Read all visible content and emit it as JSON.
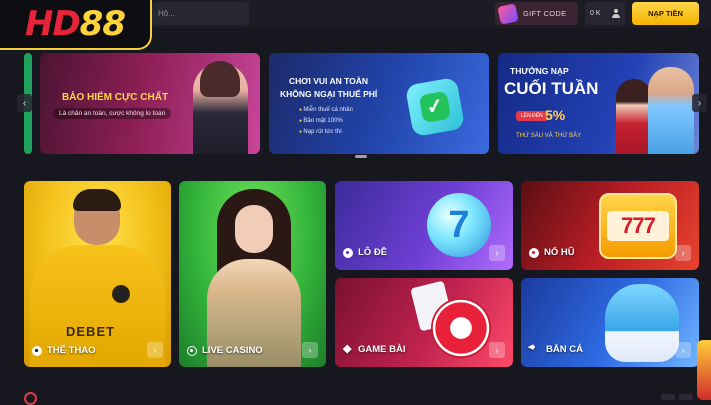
{
  "header": {
    "logo_hd": "HD",
    "logo_88": "88",
    "search_placeholder": "Hộ...",
    "gift_code_label": "GIFT CODE",
    "balance": "0 K",
    "deposit_label": "NẠP TIỀN",
    "colors": {
      "accent": "#ffd43b",
      "brand_red": "#e6243a"
    }
  },
  "banners": [
    {
      "title": "BẢO HIỂM CỰC CHẤT",
      "subtitle": "Là chân an toàn, cược không lo toan"
    },
    {
      "title_line1": "CHƠI VUI AN TOÀN",
      "title_line2": "KHÔNG NGẠI THUẾ PHÍ",
      "bullets": [
        "Miễn thuế cá nhân",
        "Bảo mật 100%",
        "Nạp rút tức thì"
      ]
    },
    {
      "title_line1": "THƯỞNG NẠP",
      "title_line2": "CUỐI TUẦN",
      "pill": "LÊN ĐẾN",
      "percent": "5%",
      "days": "THỨ SÁU VÀ THỨ BẢY"
    }
  ],
  "carousel": {
    "prev_icon": "chevron-left-icon",
    "next_icon": "chevron-right-icon",
    "prev_glyph": "‹",
    "next_glyph": "›"
  },
  "categories": {
    "sport": {
      "label": "THỂ THAO",
      "sponsor": "DEBET",
      "icon": "soccer-ball-icon"
    },
    "live_casino": {
      "label": "LIVE CASINO",
      "icon": "live-icon"
    },
    "lode": {
      "label": "LÔ ĐỀ",
      "number": "7",
      "icon": "lottery-ball-icon"
    },
    "nohu": {
      "label": "NỔ HŨ",
      "reels": "777",
      "icon": "slot-icon"
    },
    "game_bai": {
      "label": "GAME BÀI",
      "icon": "cards-icon"
    },
    "ban_ca": {
      "label": "BẮN CÁ",
      "icon": "fish-icon"
    },
    "go_glyph": "›"
  },
  "section": {
    "title": ""
  }
}
